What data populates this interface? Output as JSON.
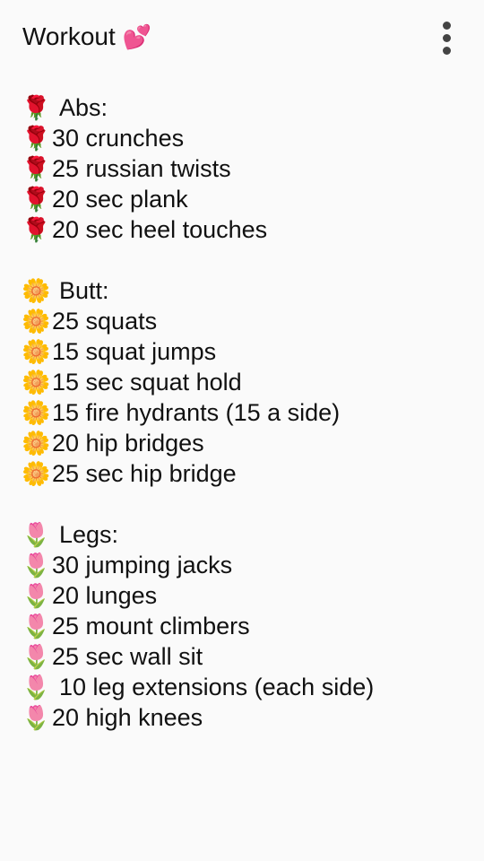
{
  "header": {
    "title": "Workout",
    "title_emoji": "💕",
    "more_icon": "more-vertical-icon"
  },
  "note": {
    "sections": [
      {
        "emoji": "🌹",
        "heading": "Abs:",
        "items": [
          "30 crunches",
          "25 russian twists",
          "20 sec plank",
          "20 sec heel touches"
        ]
      },
      {
        "emoji": "🌼",
        "heading": "Butt:",
        "items": [
          "25 squats",
          "15 squat jumps",
          "15 sec squat hold",
          "15 fire hydrants (15 a side)",
          "20 hip bridges",
          "25 sec hip bridge"
        ]
      },
      {
        "emoji": "🌷",
        "heading": "Legs:",
        "items": [
          "30 jumping jacks",
          "20 lunges",
          "25 mount climbers",
          "25 sec wall sit",
          "10 leg extensions (each side)",
          "20 high knees"
        ]
      }
    ]
  }
}
